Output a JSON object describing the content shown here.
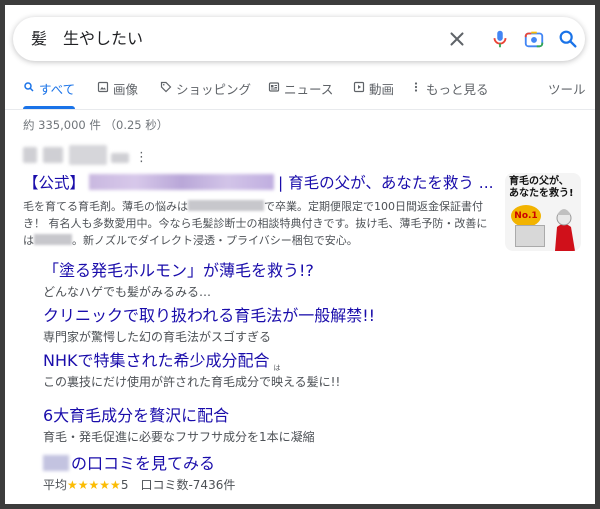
{
  "search": {
    "query": "髪　生やしたい",
    "clear_icon": "close-icon",
    "voice_icon": "mic-icon",
    "lens_icon": "camera-icon",
    "search_icon": "search-icon"
  },
  "tabs": [
    {
      "label": "すべて",
      "icon": "search-icon",
      "active": true
    },
    {
      "label": "画像",
      "icon": "image-icon",
      "active": false
    },
    {
      "label": "ショッピング",
      "icon": "tag-icon",
      "active": false
    },
    {
      "label": "ニュース",
      "icon": "news-icon",
      "active": false
    },
    {
      "label": "動画",
      "icon": "play-icon",
      "active": false
    },
    {
      "label": "もっと見る",
      "icon": "more-vert-icon",
      "active": false
    },
    {
      "label": "ツール",
      "icon": "",
      "active": false
    }
  ],
  "result_stats": "約 335,000 件 （0.25 秒）",
  "colors": {
    "link": "#1a0dab",
    "accent": "#1a73e8",
    "star": "#fbbc04"
  },
  "ad": {
    "title_prefix": "【公式】",
    "title_suffix": "| 育毛の父が、あなたを救う ...",
    "desc_1": "毛を育てる育毛剤。薄毛の悩みは",
    "desc_2": "で卒業。定期便限定で100日間返金保証書付き！ 有名人も多数愛用中。今なら毛髪診断士の相談特典付きです。抜け毛、薄毛予防・改善には",
    "desc_3": "。新ノズルでダイレクト浸透・プライバシー梱包で安心。",
    "thumb_text_1": "育毛の父が、",
    "thumb_text_2": "あなたを救う!",
    "thumb_badge": "No.1"
  },
  "sitelinks": [
    {
      "title": "「塗る発毛ホルモン」が薄毛を救う!?",
      "desc": "どんなハゲでも髪がみるみる…"
    },
    {
      "title": "クリニックで取り扱われる育毛法が一般解禁!!",
      "desc": "専門家が驚愕した幻の育毛法がスゴすぎる"
    },
    {
      "title": "NHKで特集された希少成分配合",
      "desc_before": "この裏技にだけ使用が許された育毛成分で",
      "desc_ruby_base": "映",
      "desc_ruby_text": "は",
      "desc_after": "える髪に!!"
    },
    {
      "title": "6大育毛成分を贅沢に配合",
      "desc": "育毛・発毛促進に必要なフサフサ成分を1本に凝縮"
    },
    {
      "title_suffix": "の口コミを見てみる",
      "rating_prefix": "平均",
      "stars": "★★★★★",
      "rating_value": "5",
      "reviews": "口コミ数-7436件"
    }
  ]
}
